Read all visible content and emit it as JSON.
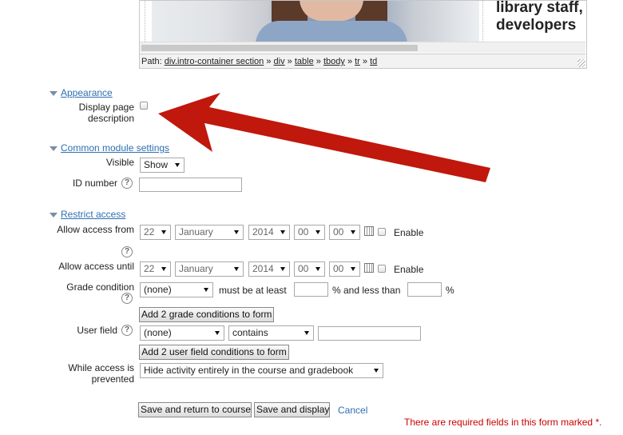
{
  "editor": {
    "photo_text": "library staff, developers",
    "path_label": "Path:",
    "path_items": [
      "div.intro-container section",
      "div",
      "table",
      "tbody",
      "tr",
      "td"
    ],
    "path_sep": "»"
  },
  "appearance": {
    "heading": "Appearance",
    "display_desc_label": "Display page description"
  },
  "common": {
    "heading": "Common module settings",
    "visible_label": "Visible",
    "visible_value": "Show",
    "idnumber_label": "ID number",
    "idnumber_value": ""
  },
  "restrict": {
    "heading": "Restrict access",
    "from_label": "Allow access from",
    "until_label": "Allow access until",
    "day": "22",
    "month": "January",
    "year": "2014",
    "hour": "00",
    "minute": "00",
    "enable_label": "Enable",
    "grade_label": "Grade condition",
    "grade_value": "(none)",
    "must_be_at_least": "must be at least",
    "pct_and_less_than": "% and less than",
    "pct": "%",
    "add_grade_btn": "Add 2 grade conditions to form",
    "userfield_label": "User field",
    "userfield_value": "(none)",
    "operator_value": "contains",
    "add_user_btn": "Add 2 user field conditions to form",
    "while_label": "While access is prevented",
    "while_value": "Hide activity entirely in the course and gradebook"
  },
  "actions": {
    "save_return": "Save and return to course",
    "save_display": "Save and display",
    "cancel": "Cancel"
  },
  "required_note": "There are required fields in this form marked",
  "required_mark": "*.",
  "help_glyph": "?",
  "arrow_color": "#c0180c"
}
